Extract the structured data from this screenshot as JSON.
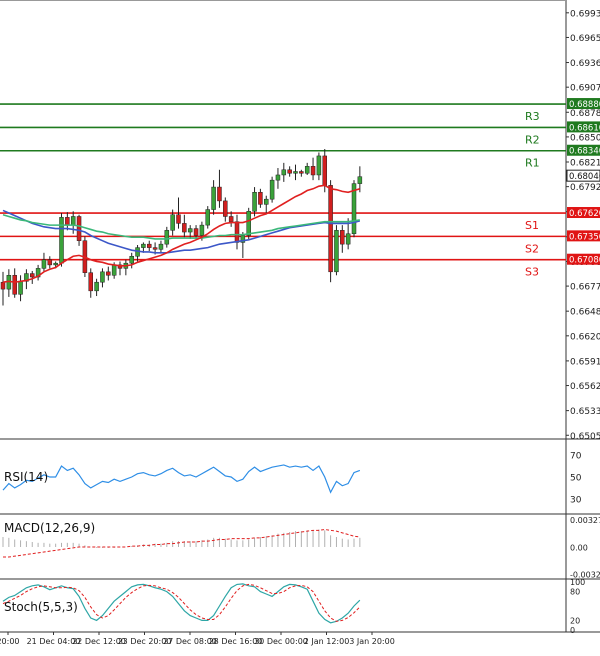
{
  "colors": {
    "bull": "#3aa23a",
    "bear": "#d11f1f",
    "resistance": "#1f7a1f",
    "support": "#e01414",
    "ma_fast": "#e02020",
    "ma_mid": "#3bb87a",
    "ma_slow": "#3c57c8",
    "rsi": "#2e8ee6",
    "macd_hist": "#b0b0b0",
    "macd_signal": "#e02020",
    "stoch_k": "#2ea6a6",
    "stoch_d": "#e02020",
    "grid": "#bbbbbb",
    "axis": "#333333"
  },
  "chart_data": {
    "type": "candlestick",
    "price_axis": {
      "ticks": [
        "0.69935",
        "0.69650",
        "0.69360",
        "0.69075",
        "0.68785",
        "0.68500",
        "0.68210",
        "0.67925",
        "0.67635",
        "0.67345",
        "0.67060",
        "0.66775",
        "0.66485",
        "0.66200",
        "0.65910",
        "0.65625",
        "0.65335",
        "0.65050"
      ],
      "tick_values": [
        0.69935,
        0.6965,
        0.6936,
        0.69075,
        0.68785,
        0.685,
        0.6821,
        0.67925,
        0.67635,
        0.67345,
        0.6706,
        0.66775,
        0.66485,
        0.662,
        0.6591,
        0.65625,
        0.65335,
        0.6505
      ],
      "ylim": [
        0.6503,
        0.7006
      ]
    },
    "time_axis": {
      "labels": [
        "20:00",
        "21 Dec 04:00",
        "22 Dec 12:00",
        "23 Dec 20:00",
        "27 Dec 08:00",
        "28 Dec 16:00",
        "30 Dec 00:00",
        "2 Jan 12:00",
        "3 Jan 20:00"
      ]
    },
    "levels": [
      {
        "name": "R3",
        "label": "0.68880",
        "value": 0.6888,
        "kind": "resistance"
      },
      {
        "name": "R2",
        "label": "0.68610",
        "value": 0.6861,
        "kind": "resistance"
      },
      {
        "name": "R1",
        "label": "0.68340",
        "value": 0.6834,
        "kind": "resistance"
      },
      {
        "name": "S1",
        "label": "0.67620",
        "value": 0.6762,
        "kind": "support"
      },
      {
        "name": "S2",
        "label": "0.67350",
        "value": 0.6735,
        "kind": "support"
      },
      {
        "name": "S3",
        "label": "0.67080",
        "value": 0.6708,
        "kind": "support"
      }
    ],
    "current_price": {
      "label": "0.68046",
      "value": 0.68046
    },
    "candles": [
      [
        0.6682,
        0.6694,
        0.6655,
        0.6674
      ],
      [
        0.6674,
        0.6697,
        0.6665,
        0.669
      ],
      [
        0.669,
        0.6698,
        0.6664,
        0.6668
      ],
      [
        0.6668,
        0.669,
        0.666,
        0.6683
      ],
      [
        0.6683,
        0.6697,
        0.6674,
        0.6692
      ],
      [
        0.6692,
        0.6695,
        0.668,
        0.6688
      ],
      [
        0.6688,
        0.6702,
        0.6684,
        0.6698
      ],
      [
        0.6698,
        0.6716,
        0.6694,
        0.6708
      ],
      [
        0.6708,
        0.6712,
        0.6698,
        0.6702
      ],
      [
        0.6702,
        0.6706,
        0.6698,
        0.6704
      ],
      [
        0.6704,
        0.6762,
        0.67,
        0.6757
      ],
      [
        0.6757,
        0.6763,
        0.6742,
        0.6748
      ],
      [
        0.6748,
        0.6764,
        0.6738,
        0.6758
      ],
      [
        0.6758,
        0.676,
        0.6724,
        0.673
      ],
      [
        0.673,
        0.6735,
        0.6688,
        0.6693
      ],
      [
        0.6693,
        0.6698,
        0.6664,
        0.6672
      ],
      [
        0.6672,
        0.6686,
        0.6666,
        0.6682
      ],
      [
        0.6682,
        0.6698,
        0.6676,
        0.6694
      ],
      [
        0.6694,
        0.67,
        0.6684,
        0.669
      ],
      [
        0.669,
        0.6705,
        0.6686,
        0.6702
      ],
      [
        0.6702,
        0.6706,
        0.669,
        0.6698
      ],
      [
        0.6698,
        0.6708,
        0.669,
        0.6704
      ],
      [
        0.6704,
        0.6716,
        0.6698,
        0.6712
      ],
      [
        0.6712,
        0.6725,
        0.6706,
        0.6722
      ],
      [
        0.6722,
        0.6728,
        0.6716,
        0.6726
      ],
      [
        0.6726,
        0.673,
        0.6718,
        0.6722
      ],
      [
        0.6722,
        0.6728,
        0.6714,
        0.672
      ],
      [
        0.672,
        0.673,
        0.6716,
        0.6726
      ],
      [
        0.6726,
        0.6746,
        0.6722,
        0.6742
      ],
      [
        0.6742,
        0.6766,
        0.6736,
        0.676
      ],
      [
        0.676,
        0.678,
        0.6744,
        0.675
      ],
      [
        0.675,
        0.676,
        0.6734,
        0.674
      ],
      [
        0.674,
        0.6748,
        0.6732,
        0.6744
      ],
      [
        0.6744,
        0.6748,
        0.6732,
        0.6736
      ],
      [
        0.6736,
        0.6752,
        0.673,
        0.6748
      ],
      [
        0.6748,
        0.677,
        0.6744,
        0.6766
      ],
      [
        0.6766,
        0.68,
        0.676,
        0.6792
      ],
      [
        0.6792,
        0.6812,
        0.6768,
        0.6776
      ],
      [
        0.6776,
        0.678,
        0.6752,
        0.6758
      ],
      [
        0.6758,
        0.6764,
        0.6746,
        0.6752
      ],
      [
        0.6752,
        0.676,
        0.672,
        0.6728
      ],
      [
        0.6728,
        0.674,
        0.671,
        0.6736
      ],
      [
        0.6736,
        0.6768,
        0.6732,
        0.6764
      ],
      [
        0.6764,
        0.6792,
        0.6758,
        0.6786
      ],
      [
        0.6786,
        0.679,
        0.6768,
        0.6772
      ],
      [
        0.6772,
        0.6782,
        0.6762,
        0.6778
      ],
      [
        0.6778,
        0.6804,
        0.6774,
        0.68
      ],
      [
        0.68,
        0.6814,
        0.679,
        0.6806
      ],
      [
        0.6806,
        0.682,
        0.6798,
        0.6812
      ],
      [
        0.6812,
        0.6816,
        0.6804,
        0.6808
      ],
      [
        0.6808,
        0.6818,
        0.68,
        0.681
      ],
      [
        0.681,
        0.6812,
        0.6804,
        0.6808
      ],
      [
        0.6808,
        0.682,
        0.6806,
        0.6816
      ],
      [
        0.6816,
        0.6826,
        0.68,
        0.6806
      ],
      [
        0.6806,
        0.6832,
        0.68,
        0.6828
      ],
      [
        0.6828,
        0.6836,
        0.6786,
        0.6794
      ],
      [
        0.6794,
        0.68,
        0.6682,
        0.6694
      ],
      [
        0.6694,
        0.6748,
        0.669,
        0.6742
      ],
      [
        0.6742,
        0.6748,
        0.6716,
        0.6726
      ],
      [
        0.6726,
        0.6756,
        0.672,
        0.6738
      ],
      [
        0.6738,
        0.68,
        0.6734,
        0.6796
      ],
      [
        0.6796,
        0.6816,
        0.6786,
        0.6804
      ]
    ],
    "ma_fast": [
      0.6682,
      0.6683,
      0.6682,
      0.6683,
      0.6684,
      0.6686,
      0.6689,
      0.6694,
      0.6697,
      0.6699,
      0.6704,
      0.6708,
      0.6712,
      0.6713,
      0.6711,
      0.6708,
      0.6706,
      0.6705,
      0.6703,
      0.6702,
      0.6701,
      0.6701,
      0.6702,
      0.6705,
      0.6707,
      0.6709,
      0.6711,
      0.6713,
      0.6716,
      0.672,
      0.6723,
      0.6726,
      0.6728,
      0.6731,
      0.6734,
      0.6738,
      0.6743,
      0.6747,
      0.675,
      0.6751,
      0.6751,
      0.6751,
      0.6753,
      0.6756,
      0.6759,
      0.6761,
      0.6765,
      0.6769,
      0.6773,
      0.6777,
      0.6781,
      0.6784,
      0.6788,
      0.679,
      0.6793,
      0.6794,
      0.679,
      0.6789,
      0.6787,
      0.6786,
      0.6788,
      0.679
    ],
    "ma_mid": [
      0.676,
      0.6758,
      0.6756,
      0.6754,
      0.6753,
      0.6751,
      0.675,
      0.6749,
      0.6748,
      0.6748,
      0.6748,
      0.6748,
      0.6748,
      0.6747,
      0.6745,
      0.6743,
      0.6741,
      0.674,
      0.6738,
      0.6737,
      0.6736,
      0.6735,
      0.6734,
      0.6734,
      0.6734,
      0.6733,
      0.6732,
      0.6732,
      0.6732,
      0.6733,
      0.6733,
      0.6733,
      0.6733,
      0.6733,
      0.6733,
      0.6734,
      0.6735,
      0.6736,
      0.6736,
      0.6737,
      0.6737,
      0.6737,
      0.6738,
      0.6739,
      0.674,
      0.6741,
      0.6742,
      0.6744,
      0.6745,
      0.6746,
      0.6747,
      0.6748,
      0.6749,
      0.675,
      0.6751,
      0.6752,
      0.6752,
      0.6752,
      0.6752,
      0.6752,
      0.6753,
      0.6754
    ],
    "ma_slow": [
      0.6765,
      0.6762,
      0.6759,
      0.6756,
      0.6753,
      0.675,
      0.6748,
      0.6746,
      0.6745,
      0.6744,
      0.6744,
      0.6744,
      0.6743,
      0.6742,
      0.674,
      0.6736,
      0.6733,
      0.673,
      0.6727,
      0.6725,
      0.6723,
      0.6721,
      0.6719,
      0.6718,
      0.6717,
      0.6717,
      0.6716,
      0.6716,
      0.6716,
      0.6717,
      0.6718,
      0.6719,
      0.6719,
      0.672,
      0.6721,
      0.6722,
      0.6724,
      0.6726,
      0.6727,
      0.6728,
      0.6729,
      0.673,
      0.6731,
      0.6733,
      0.6735,
      0.6737,
      0.6739,
      0.6741,
      0.6743,
      0.6745,
      0.6746,
      0.6747,
      0.6748,
      0.6749,
      0.675,
      0.6751,
      0.675,
      0.675,
      0.675,
      0.675,
      0.6751,
      0.6753
    ],
    "rsi": {
      "label": "RSI(14)",
      "ticks": [
        "70",
        "50",
        "30"
      ],
      "tick_values": [
        70,
        50,
        30
      ],
      "ylim": [
        18,
        82
      ],
      "values": [
        38,
        44,
        40,
        43,
        47,
        46,
        49,
        52,
        50,
        50,
        60,
        56,
        58,
        52,
        44,
        40,
        43,
        46,
        45,
        48,
        46,
        48,
        50,
        53,
        54,
        52,
        51,
        53,
        56,
        58,
        54,
        51,
        52,
        50,
        53,
        56,
        59,
        55,
        51,
        50,
        46,
        48,
        55,
        59,
        55,
        57,
        59,
        60,
        61,
        59,
        60,
        59,
        60,
        56,
        60,
        50,
        36,
        46,
        42,
        44,
        54,
        56
      ]
    },
    "macd": {
      "label": "MACD(12,26,9)",
      "ticks": [
        "0.003275",
        "0.00",
        "-0.003234"
      ],
      "tick_values": [
        0.003275,
        0,
        -0.003234
      ],
      "ylim": [
        -0.0036,
        0.0036
      ],
      "hist": [
        0.0012,
        0.0011,
        0.0009,
        0.0008,
        0.0007,
        0.0006,
        0.0005,
        0.0005,
        0.0004,
        0.0004,
        0.0005,
        0.0005,
        0.0005,
        0.0004,
        0.0002,
        0.0,
        -0.0001,
        -0.0001,
        -0.0001,
        -0.0001,
        0.0,
        0.0,
        0.0001,
        0.0002,
        0.0003,
        0.0003,
        0.0004,
        0.0004,
        0.0005,
        0.0007,
        0.0007,
        0.0007,
        0.0007,
        0.0007,
        0.0008,
        0.0009,
        0.0011,
        0.0011,
        0.001,
        0.0009,
        0.0008,
        0.0008,
        0.0009,
        0.0011,
        0.0012,
        0.0013,
        0.0014,
        0.0016,
        0.0017,
        0.0018,
        0.0019,
        0.0019,
        0.002,
        0.002,
        0.0021,
        0.002,
        0.0014,
        0.0012,
        0.001,
        0.0009,
        0.001,
        0.0011
      ],
      "signal": [
        -0.0012,
        -0.0012,
        -0.0011,
        -0.001,
        -0.0009,
        -0.0008,
        -0.0007,
        -0.0006,
        -0.0005,
        -0.0004,
        -0.0003,
        -0.0002,
        -0.0001,
        0.0,
        0.0,
        0.0,
        0.0,
        0.0,
        0.0,
        0.0,
        0.0,
        0.0,
        0.0001,
        0.0001,
        0.0002,
        0.0002,
        0.0003,
        0.0003,
        0.0004,
        0.0004,
        0.0005,
        0.0006,
        0.0006,
        0.0006,
        0.0007,
        0.0007,
        0.0008,
        0.0009,
        0.0009,
        0.001,
        0.001,
        0.001,
        0.001,
        0.0011,
        0.0011,
        0.0012,
        0.0013,
        0.0014,
        0.0015,
        0.0016,
        0.0017,
        0.0018,
        0.0019,
        0.002,
        0.002,
        0.0021,
        0.002,
        0.0019,
        0.0017,
        0.0015,
        0.0013,
        0.0012
      ]
    },
    "stoch": {
      "label": "Stoch(5,5,3)",
      "ticks": [
        "100",
        "80",
        "20",
        "0"
      ],
      "tick_values": [
        100,
        80,
        20,
        0
      ],
      "ylim": [
        0,
        100
      ],
      "k": [
        60,
        68,
        72,
        80,
        88,
        92,
        94,
        90,
        84,
        88,
        92,
        88,
        86,
        70,
        45,
        25,
        20,
        30,
        45,
        60,
        70,
        80,
        90,
        94,
        95,
        92,
        88,
        85,
        80,
        70,
        55,
        40,
        30,
        25,
        20,
        20,
        30,
        50,
        70,
        88,
        95,
        96,
        92,
        90,
        80,
        75,
        70,
        80,
        90,
        95,
        94,
        90,
        85,
        60,
        35,
        22,
        15,
        18,
        25,
        35,
        50,
        62
      ],
      "d": [
        55,
        60,
        66,
        72,
        80,
        86,
        90,
        92,
        90,
        88,
        88,
        89,
        88,
        82,
        68,
        48,
        32,
        25,
        30,
        42,
        55,
        68,
        78,
        86,
        92,
        93,
        92,
        88,
        85,
        78,
        68,
        55,
        42,
        32,
        25,
        22,
        22,
        32,
        48,
        66,
        82,
        92,
        95,
        93,
        88,
        82,
        76,
        76,
        80,
        88,
        92,
        93,
        90,
        80,
        60,
        40,
        25,
        18,
        20,
        26,
        36,
        48
      ]
    }
  }
}
